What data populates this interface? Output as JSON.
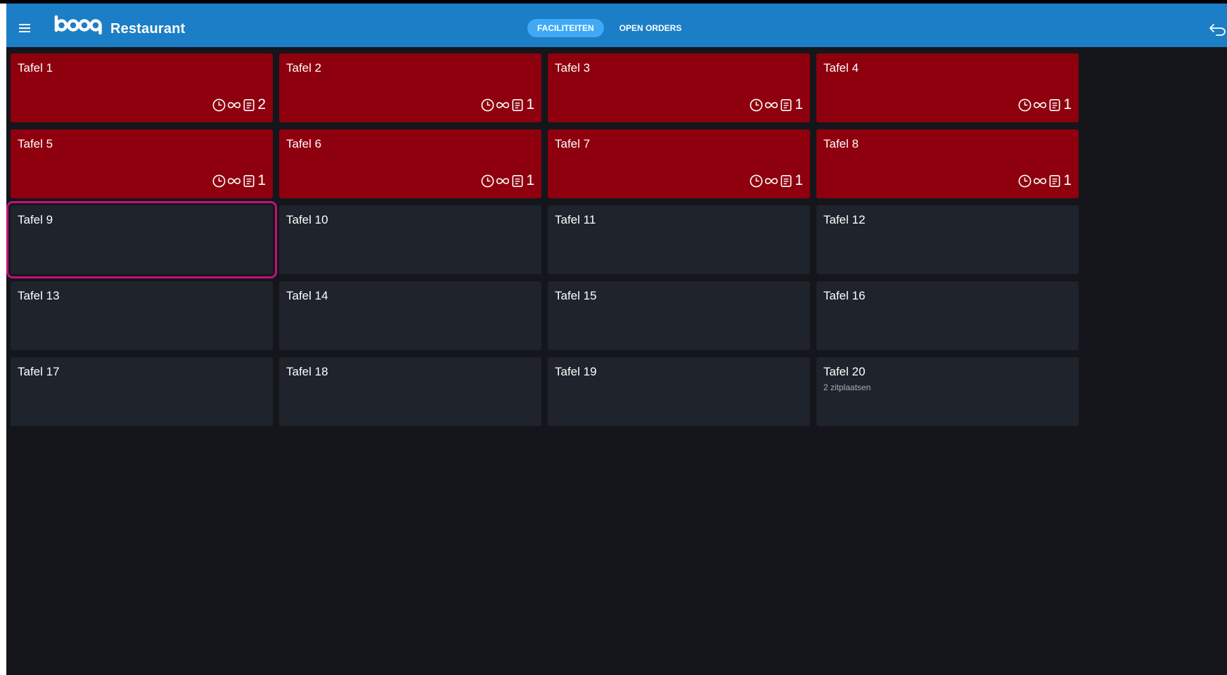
{
  "header": {
    "title": "Restaurant",
    "logo_text": "booq",
    "tabs": [
      {
        "label": "FACILITEITEN",
        "active": true
      },
      {
        "label": "OPEN ORDERS",
        "active": false
      }
    ],
    "back_icon": "undo-arrow-icon",
    "menu_icon": "hamburger-menu-icon"
  },
  "colors": {
    "header": "#1c7ec6",
    "active_tab": "#3fa9f5",
    "occupied": "#8e000e",
    "free": "#1f232b",
    "selected_outline": "#c4107a",
    "background": "#14161b"
  },
  "tables": [
    {
      "name": "Tafel 1",
      "status": "occupied",
      "orders": "2"
    },
    {
      "name": "Tafel 2",
      "status": "occupied",
      "orders": "1"
    },
    {
      "name": "Tafel 3",
      "status": "occupied",
      "orders": "1"
    },
    {
      "name": "Tafel 4",
      "status": "occupied",
      "orders": "1"
    },
    {
      "name": "Tafel 5",
      "status": "occupied",
      "orders": "1"
    },
    {
      "name": "Tafel 6",
      "status": "occupied",
      "orders": "1"
    },
    {
      "name": "Tafel 7",
      "status": "occupied",
      "orders": "1"
    },
    {
      "name": "Tafel 8",
      "status": "occupied",
      "orders": "1"
    },
    {
      "name": "Tafel 9",
      "status": "free",
      "selected": true
    },
    {
      "name": "Tafel 10",
      "status": "free"
    },
    {
      "name": "Tafel 11",
      "status": "free"
    },
    {
      "name": "Tafel 12",
      "status": "free"
    },
    {
      "name": "Tafel 13",
      "status": "free"
    },
    {
      "name": "Tafel 14",
      "status": "free"
    },
    {
      "name": "Tafel 15",
      "status": "free"
    },
    {
      "name": "Tafel 16",
      "status": "free"
    },
    {
      "name": "Tafel 17",
      "status": "free"
    },
    {
      "name": "Tafel 18",
      "status": "free"
    },
    {
      "name": "Tafel 19",
      "status": "free"
    },
    {
      "name": "Tafel 20",
      "status": "free",
      "seats": "2 zitplaatsen"
    }
  ],
  "tile_icons": [
    "clock-icon",
    "infinity-icon",
    "receipt-icon"
  ]
}
